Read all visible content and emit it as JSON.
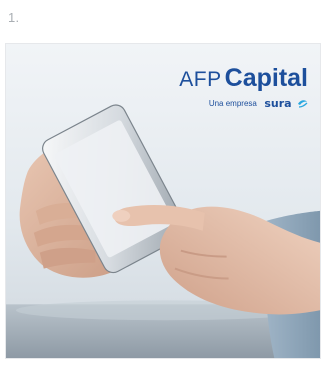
{
  "step": {
    "number": "1."
  },
  "card": {
    "brand": {
      "prefix": "AFP",
      "name": "Capital",
      "tagline_lead": "Una empresa",
      "tagline_brand": "sura",
      "color": "#1d4f9c",
      "accent": "#29a8e0"
    },
    "photo": {
      "subject": "hands holding smartphone"
    }
  }
}
